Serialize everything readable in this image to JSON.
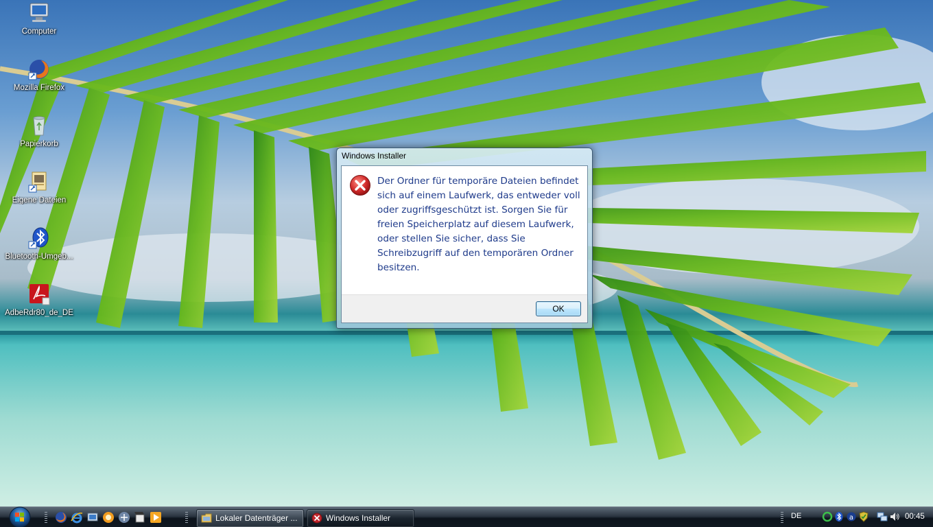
{
  "desktop": {
    "icons": [
      {
        "label": "Computer",
        "icon": "computer-icon"
      },
      {
        "label": "Mozilla Firefox",
        "icon": "firefox-icon"
      },
      {
        "label": "Papierkorb",
        "icon": "recycle-bin-icon"
      },
      {
        "label": "Eigene Dateien",
        "icon": "documents-icon"
      },
      {
        "label": "Bluetooth-Umgeb...",
        "icon": "bluetooth-icon"
      },
      {
        "label": "AdbeRdr80_de_DE",
        "icon": "adobe-reader-icon"
      }
    ]
  },
  "dialog": {
    "title": "Windows Installer",
    "icon": "error-icon",
    "message": "Der Ordner für temporäre Dateien befindet sich auf einem Laufwerk, das entweder voll oder zugriffsgeschützt ist. Sorgen Sie für freien Speicherplatz auf diesem Laufwerk, oder stellen Sie sicher, dass Sie Schreibzugriff auf den temporären Ordner besitzen.",
    "ok_label": "OK"
  },
  "taskbar": {
    "quick_launch": [
      "firefox-icon",
      "internet-explorer-icon",
      "show-desktop-icon",
      "media-center-icon",
      "network-icon",
      "windows-movie-maker-icon",
      "media-player-icon"
    ],
    "buttons": [
      {
        "label": "Lokaler Datenträger ...",
        "icon": "folder-icon",
        "active": false
      },
      {
        "label": "Windows Installer",
        "icon": "error-icon",
        "active": true
      }
    ],
    "language": "DE",
    "tray_icons": [
      "network-sync-icon",
      "bluetooth-icon",
      "antivirus-icon",
      "shield-icon",
      "network-icon",
      "volume-icon"
    ],
    "clock": "00:45"
  },
  "colors": {
    "message_text": "#1e3a8a",
    "error_red": "#c0262d",
    "taskbar": "#1a232d"
  }
}
